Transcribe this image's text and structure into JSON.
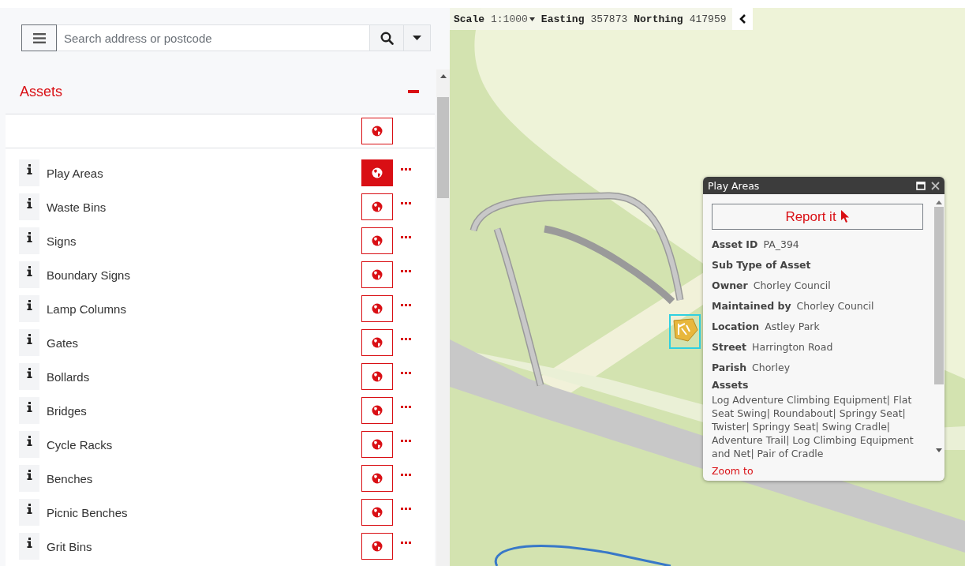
{
  "search": {
    "placeholder": "Search address or postcode"
  },
  "panel": {
    "title": "Assets",
    "expanded": true,
    "all_visible": false,
    "layers": [
      {
        "label": "Play Areas",
        "visible": true
      },
      {
        "label": "Waste Bins",
        "visible": false
      },
      {
        "label": "Signs",
        "visible": false
      },
      {
        "label": "Boundary Signs",
        "visible": false
      },
      {
        "label": "Lamp Columns",
        "visible": false
      },
      {
        "label": "Gates",
        "visible": false
      },
      {
        "label": "Bollards",
        "visible": false
      },
      {
        "label": "Bridges",
        "visible": false
      },
      {
        "label": "Cycle Racks",
        "visible": false
      },
      {
        "label": "Benches",
        "visible": false
      },
      {
        "label": "Picnic Benches",
        "visible": false
      },
      {
        "label": "Grit Bins",
        "visible": false
      }
    ]
  },
  "map_bar": {
    "scale_label": "Scale",
    "scale": "1:1000",
    "easting_label": "Easting",
    "easting": "357873",
    "northing_label": "Northing",
    "northing": "417959"
  },
  "popup": {
    "title": "Play Areas",
    "report_button": "Report it",
    "fields": [
      {
        "kind": "inline",
        "label": "Asset ID",
        "value": "PA_394"
      },
      {
        "kind": "inline",
        "label": "Sub Type of Asset"
      },
      {
        "kind": "inline",
        "label": "Owner",
        "value": "Chorley Council"
      },
      {
        "kind": "inline",
        "label": "Maintained by",
        "value": "Chorley Council"
      },
      {
        "kind": "inline",
        "label": "Location",
        "value": "Astley Park"
      },
      {
        "kind": "inline",
        "label": "Street",
        "value": "Harrington Road"
      },
      {
        "kind": "inline",
        "label": "Parish",
        "value": "Chorley"
      },
      {
        "kind": "block",
        "label": "Assets",
        "value": "Log Adventure Climbing Equipment| Flat Seat Swing| Roundabout| Springy Seat| Twister| Springy Seat| Swing Cradle| Adventure Trail| Log Climbing Equipment and Net| Pair of Cradle"
      }
    ],
    "zoom_link": "Zoom to"
  }
}
